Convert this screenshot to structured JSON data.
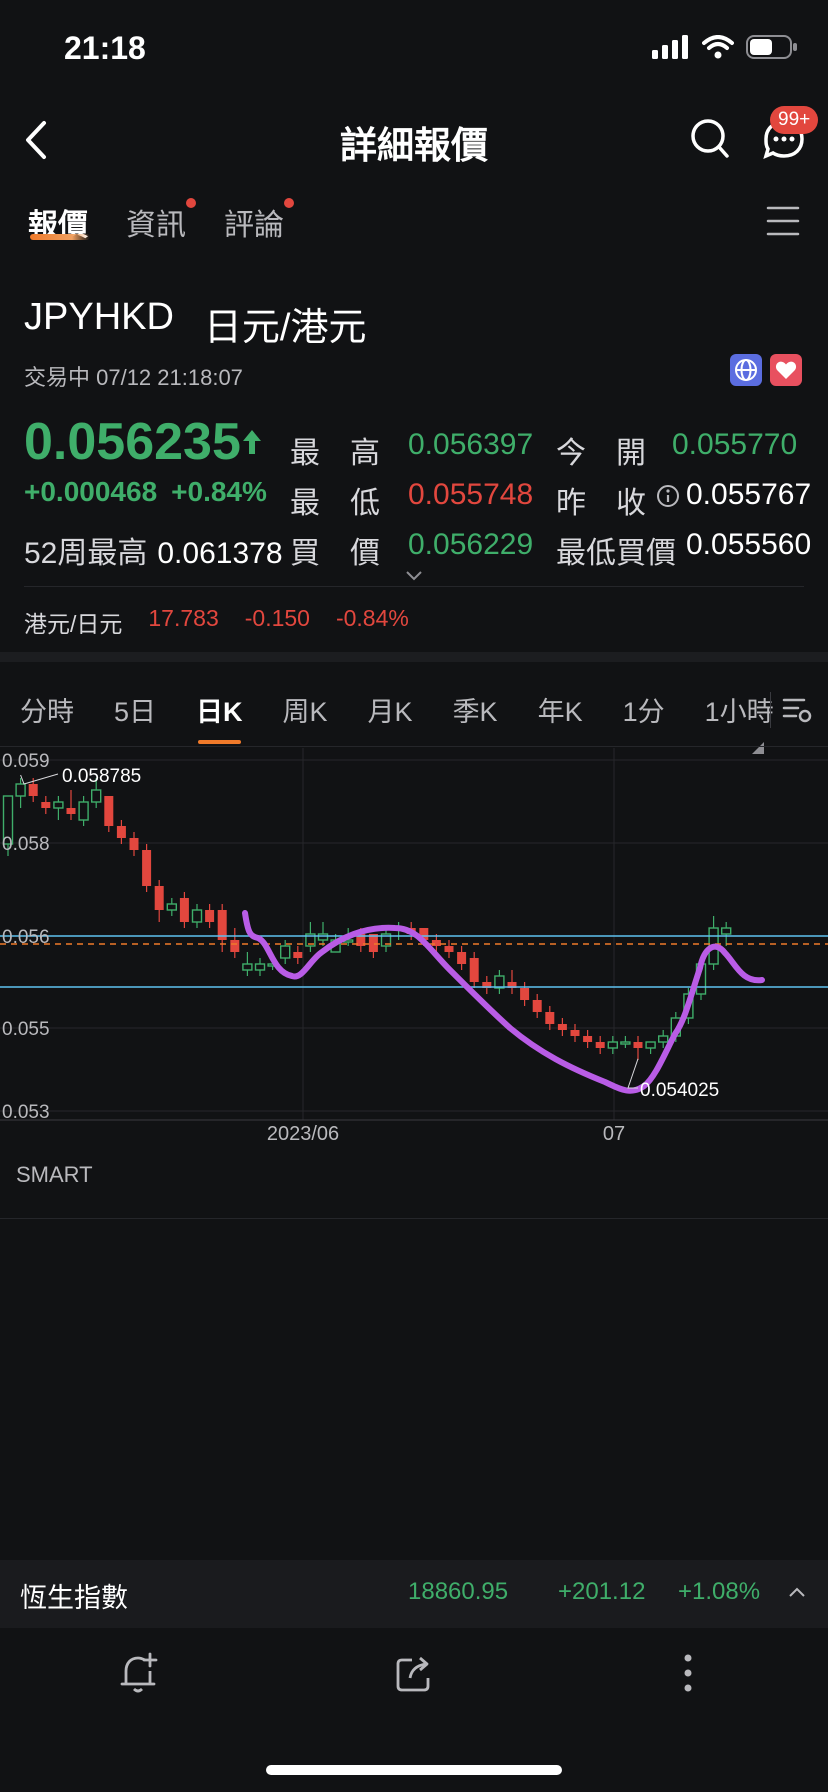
{
  "status_bar": {
    "time": "21:18"
  },
  "nav": {
    "title": "詳細報價",
    "badge": "99+"
  },
  "tabs": [
    {
      "label": "報價"
    },
    {
      "label": "資訊"
    },
    {
      "label": "評論"
    }
  ],
  "instrument": {
    "code": "JPYHKD",
    "name": "日元/港元",
    "status": "交易中 07/12 21:18:07"
  },
  "quote": {
    "price": "0.056235",
    "change": "+0.000468",
    "change_pct": "+0.84%",
    "high_label": "最　高",
    "high": "0.056397",
    "open_label": "今　開",
    "open": "0.055770",
    "low_label": "最　低",
    "low": "0.055748",
    "prev_close_label": "昨　收",
    "prev_close": "0.055767",
    "wk52_label": "52周最高",
    "wk52": "0.061378",
    "bid_label": "買　價",
    "bid": "0.056229",
    "min_bid_label": "最低買價",
    "min_bid": "0.055560"
  },
  "reverse": {
    "pair": "港元/日元",
    "price": "17.783",
    "change": "-0.150",
    "change_pct": "-0.84%"
  },
  "chart_tabs": [
    "分時",
    "5日",
    "日K",
    "周K",
    "月K",
    "季K",
    "年K",
    "1分",
    "1小時"
  ],
  "chart_data": {
    "type": "candlestick",
    "ylim": [
      0.053,
      0.059
    ],
    "y_ticks": [
      "0.059",
      "0.058",
      "0.056",
      "0.055",
      "0.053"
    ],
    "x_ticks": [
      "2023/06",
      "07"
    ],
    "max_label": "0.058785",
    "min_label": "0.054025",
    "candles": [
      [
        0.0576,
        0.0584,
        0.0574,
        0.0584
      ],
      [
        0.0584,
        0.0587,
        0.0582,
        0.0586
      ],
      [
        0.0586,
        0.0587,
        0.0583,
        0.0584
      ],
      [
        0.0583,
        0.0584,
        0.0581,
        0.0582
      ],
      [
        0.0582,
        0.0584,
        0.058,
        0.0583
      ],
      [
        0.0582,
        0.0585,
        0.058,
        0.0581
      ],
      [
        0.058,
        0.0584,
        0.0579,
        0.0583
      ],
      [
        0.0583,
        0.0587,
        0.0582,
        0.0585
      ],
      [
        0.0584,
        0.0584,
        0.0578,
        0.0579
      ],
      [
        0.0579,
        0.058,
        0.0576,
        0.0577
      ],
      [
        0.0577,
        0.0578,
        0.0574,
        0.0575
      ],
      [
        0.0575,
        0.0576,
        0.0568,
        0.0569
      ],
      [
        0.0569,
        0.057,
        0.0563,
        0.0565
      ],
      [
        0.0565,
        0.0567,
        0.0564,
        0.0566
      ],
      [
        0.0567,
        0.0568,
        0.0562,
        0.0563
      ],
      [
        0.0563,
        0.0566,
        0.0562,
        0.0565
      ],
      [
        0.0565,
        0.0566,
        0.0562,
        0.0563
      ],
      [
        0.0565,
        0.0566,
        0.0558,
        0.056
      ],
      [
        0.056,
        0.0562,
        0.0557,
        0.0558
      ],
      [
        0.0555,
        0.0558,
        0.0554,
        0.0556
      ],
      [
        0.0555,
        0.0557,
        0.0554,
        0.0556
      ],
      [
        0.0556,
        0.0557,
        0.0555,
        0.0556
      ],
      [
        0.0557,
        0.056,
        0.0556,
        0.0559
      ],
      [
        0.0558,
        0.0559,
        0.0556,
        0.0557
      ],
      [
        0.0559,
        0.0563,
        0.0558,
        0.0561
      ],
      [
        0.056,
        0.0563,
        0.0559,
        0.0561
      ],
      [
        0.0558,
        0.0561,
        0.0558,
        0.056
      ],
      [
        0.056,
        0.0562,
        0.0559,
        0.056
      ],
      [
        0.0561,
        0.0562,
        0.0558,
        0.0559
      ],
      [
        0.0561,
        0.0561,
        0.0557,
        0.0558
      ],
      [
        0.0559,
        0.0562,
        0.0558,
        0.0561
      ],
      [
        0.0562,
        0.0563,
        0.056,
        0.0562
      ],
      [
        0.0562,
        0.0563,
        0.056,
        0.0561
      ],
      [
        0.0562,
        0.0562,
        0.0559,
        0.056
      ],
      [
        0.056,
        0.0561,
        0.0558,
        0.0559
      ],
      [
        0.0559,
        0.056,
        0.0557,
        0.0558
      ],
      [
        0.0558,
        0.0559,
        0.0555,
        0.0556
      ],
      [
        0.0557,
        0.0558,
        0.0552,
        0.0553
      ],
      [
        0.0553,
        0.0554,
        0.0551,
        0.0552
      ],
      [
        0.0552,
        0.0555,
        0.0551,
        0.0554
      ],
      [
        0.0553,
        0.0555,
        0.0551,
        0.0552
      ],
      [
        0.0552,
        0.0553,
        0.0549,
        0.055
      ],
      [
        0.055,
        0.0551,
        0.0547,
        0.0548
      ],
      [
        0.0548,
        0.0549,
        0.0545,
        0.0546
      ],
      [
        0.0546,
        0.0547,
        0.0544,
        0.0545
      ],
      [
        0.0545,
        0.0546,
        0.0543,
        0.0544
      ],
      [
        0.0544,
        0.0545,
        0.0542,
        0.0543
      ],
      [
        0.0543,
        0.0544,
        0.0541,
        0.0542
      ],
      [
        0.0542,
        0.0544,
        0.0541,
        0.0543
      ],
      [
        0.0543,
        0.0544,
        0.0542,
        0.0543
      ],
      [
        0.0543,
        0.0544,
        0.054,
        0.0542
      ],
      [
        0.0542,
        0.0543,
        0.0541,
        0.0543
      ],
      [
        0.0543,
        0.0545,
        0.0542,
        0.0544
      ],
      [
        0.0544,
        0.0548,
        0.0543,
        0.0547
      ],
      [
        0.0547,
        0.0552,
        0.0546,
        0.0551
      ],
      [
        0.0551,
        0.0557,
        0.055,
        0.0556
      ],
      [
        0.0556,
        0.0564,
        0.0555,
        0.0562
      ],
      [
        0.0561,
        0.0563,
        0.0559,
        0.0562
      ]
    ]
  },
  "indicator": {
    "label": "SMART"
  },
  "index_bar": {
    "name": "恆生指數",
    "value": "18860.95",
    "change": "+201.12",
    "change_pct": "+1.08%"
  }
}
